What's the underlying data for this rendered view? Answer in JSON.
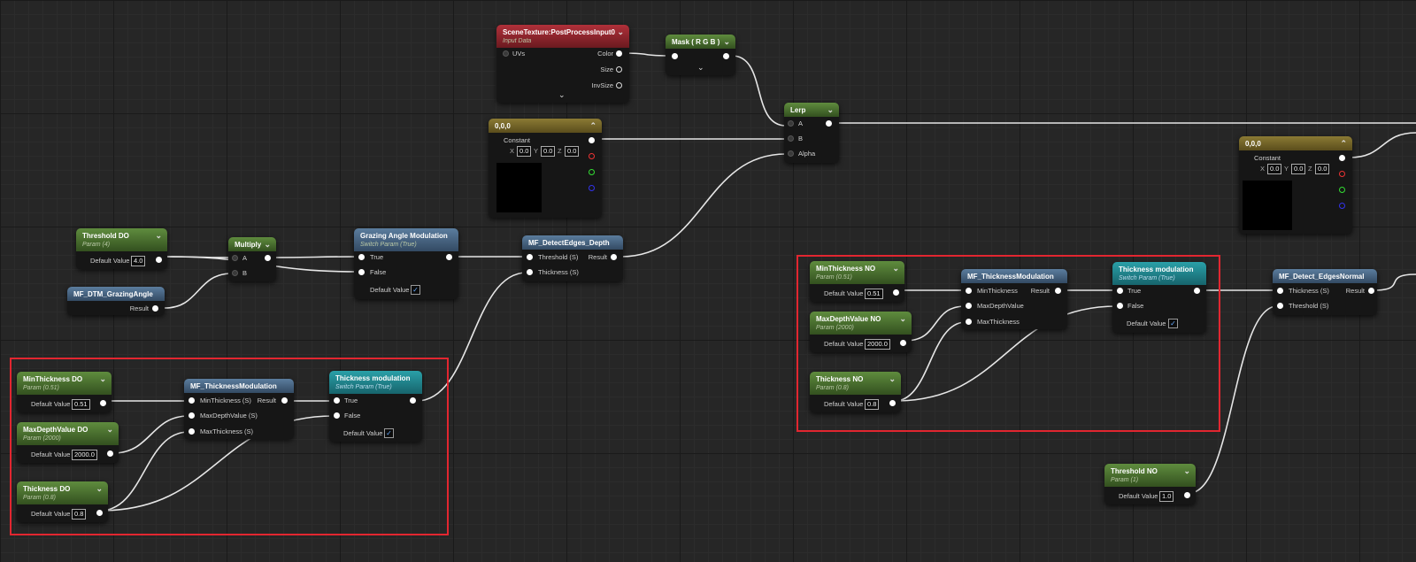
{
  "colors": {
    "param": "#4f7a34",
    "switch": "#1f8a92",
    "function": "#4d6b8a",
    "texture": "#a3283a",
    "constant": "#7d6d2d",
    "highlight": "#e22630",
    "wire": "#e6e6e6"
  },
  "icons": {
    "collapse": "chevron-down-icon",
    "expand": "chevron-up-icon",
    "checkbox": "check-icon"
  },
  "scene_texture": {
    "title": "SceneTexture:PostProcessInput0",
    "subtitle": "Input Data",
    "in_uvs": "UVs",
    "out_color": "Color",
    "out_size": "Size",
    "out_invsize": "InvSize"
  },
  "mask": {
    "title": "Mask ( R G B )"
  },
  "lerp": {
    "title": "Lerp",
    "a": "A",
    "b": "B",
    "alpha": "Alpha"
  },
  "const_center": {
    "title": "0,0,0",
    "label": "Constant",
    "x_lbl": "X",
    "x": "0.0",
    "y_lbl": "Y",
    "y": "0.0",
    "z_lbl": "Z",
    "z": "0.0"
  },
  "const_right": {
    "title": "0,0,0",
    "label": "Constant",
    "x_lbl": "X",
    "x": "0.0",
    "y_lbl": "Y",
    "y": "0.0",
    "z_lbl": "Z",
    "z": "0.0"
  },
  "threshold_do": {
    "title": "Threshold DO",
    "subtitle": "Param (4)",
    "label": "Default Value",
    "value": "4.0"
  },
  "multiply": {
    "title": "Multiply",
    "a": "A",
    "b": "B"
  },
  "grazing": {
    "title": "Grazing Angle Modulation",
    "subtitle": "Switch Param (True)",
    "in_true": "True",
    "in_false": "False",
    "default_label": "Default Value",
    "check": "✓"
  },
  "grazing_fn": {
    "title": "MF_DTM_GrazingAngle",
    "out": "Result"
  },
  "detect_depth": {
    "title": "MF_DetectEdges_Depth",
    "in_threshold": "Threshold (S)",
    "in_thickness": "Thickness (S)",
    "out": "Result"
  },
  "min_do": {
    "title": "MinThickness DO",
    "subtitle": "Param (0.51)",
    "label": "Default Value",
    "value": "0.51"
  },
  "maxd_do": {
    "title": "MaxDepthValue DO",
    "subtitle": "Param (2000)",
    "label": "Default Value",
    "value": "2000.0"
  },
  "thick_do": {
    "title": "Thickness DO",
    "subtitle": "Param (0.8)",
    "label": "Default Value",
    "value": "0.8"
  },
  "tm_fn_do": {
    "title": "MF_ThicknessModulation",
    "in_min": "MinThickness (S)",
    "in_maxd": "MaxDepthValue (S)",
    "in_max": "MaxThickness (S)",
    "out": "Result"
  },
  "tm_sw_do": {
    "title": "Thickness modulation",
    "subtitle": "Switch Param (True)",
    "in_true": "True",
    "in_false": "False",
    "default_label": "Default Value",
    "check": "✓"
  },
  "min_no": {
    "title": "MinThickness NO",
    "subtitle": "Param (0.51)",
    "label": "Default Value",
    "value": "0.51"
  },
  "maxd_no": {
    "title": "MaxDepthValue NO",
    "subtitle": "Param (2000)",
    "label": "Default Value",
    "value": "2000.0"
  },
  "thick_no": {
    "title": "Thickness NO",
    "subtitle": "Param (0.8)",
    "label": "Default Value",
    "value": "0.8"
  },
  "tm_fn_no": {
    "title": "MF_ThicknessModulation",
    "in_min": "MinThickness",
    "in_maxd": "MaxDepthValue",
    "in_max": "MaxThickness",
    "out": "Result"
  },
  "tm_sw_no": {
    "title": "Thickness modulation",
    "subtitle": "Switch Param (True)",
    "in_true": "True",
    "in_false": "False",
    "default_label": "Default Value",
    "check": "✓"
  },
  "detect_normal": {
    "title": "MF_Detect_EdgesNormal",
    "in_thickness": "Thickness (S)",
    "in_threshold": "Threshold (S)",
    "out": "Result"
  },
  "threshold_no": {
    "title": "Threshold NO",
    "subtitle": "Param (1)",
    "label": "Default Value",
    "value": "1.0"
  }
}
